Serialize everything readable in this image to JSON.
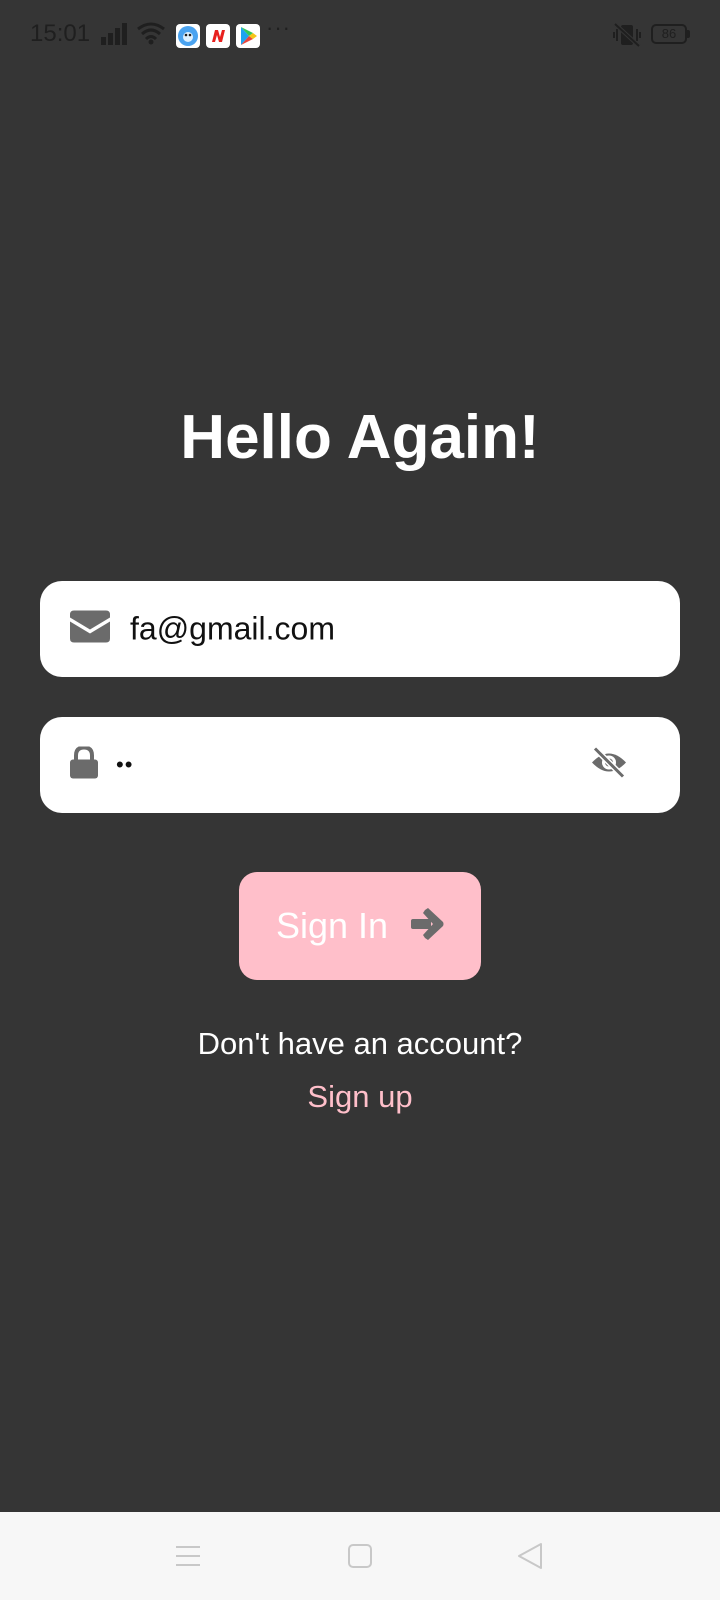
{
  "status_bar": {
    "time": "15:01",
    "battery": "86",
    "more": "···",
    "icons": [
      "signal-icon",
      "wifi-icon",
      "app-icon-bird",
      "app-icon-news",
      "app-icon-play-store",
      "more-icon",
      "vibrate-off-icon",
      "battery-icon"
    ]
  },
  "login": {
    "title": "Hello Again!",
    "email_value": "fa@gmail.com",
    "password_masked": "••",
    "signin_label": "Sign In",
    "no_account_text": "Don't have an account?",
    "signup_label": "Sign up"
  },
  "colors": {
    "background": "#353535",
    "accent": "#ffbfca",
    "field_background": "#ffffff",
    "icon_grey": "#6b6b6b"
  },
  "nav": {
    "icons": [
      "menu-icon",
      "home-square-icon",
      "back-triangle-icon"
    ]
  }
}
